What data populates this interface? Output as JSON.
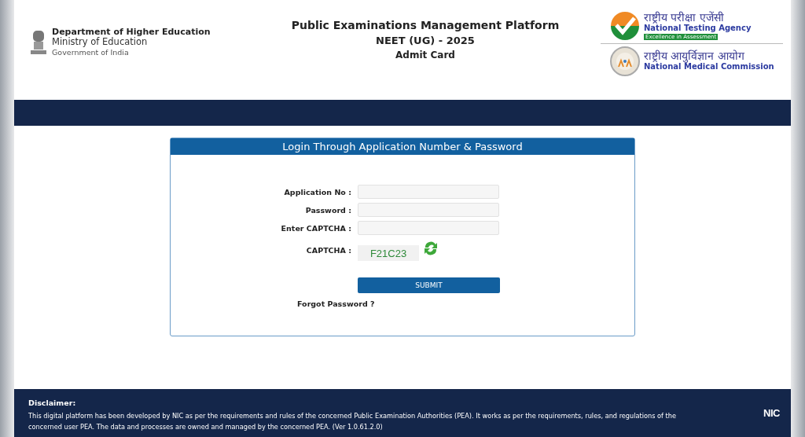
{
  "header": {
    "department": {
      "name": "Department of Higher Education",
      "ministry": "Ministry of Education",
      "government": "Government of India"
    },
    "title": "Public Examinations Management Platform",
    "subtitle": "NEET (UG) - 2025",
    "page": "Admit Card",
    "agencies": [
      {
        "kind": "nta",
        "hindi": "राष्ट्रीय परीक्षा एजेंसी",
        "english": "National Testing Agency",
        "tagline": "Excellence in Assessment"
      },
      {
        "kind": "nmc",
        "hindi": "राष्ट्रीय आयुर्विज्ञान आयोग",
        "english": "National Medical Commission"
      }
    ]
  },
  "login": {
    "title": "Login Through Application Number & Password",
    "fields": [
      {
        "kind": "input",
        "label": "Application No :"
      },
      {
        "kind": "input",
        "label": "Password :"
      },
      {
        "kind": "input",
        "label": "Enter CAPTCHA :"
      },
      {
        "kind": "captcha",
        "label": "CAPTCHA :",
        "value": "F21C23"
      }
    ],
    "submit": "SUBMIT",
    "forgot": "Forgot Password ?"
  },
  "footer": {
    "heading": "Disclaimer:",
    "text": "This digital platform has been developed by NIC as per the requirements and rules of the concerned Public Examination Authorities (PEA). It works as per the requirements, rules, and regulations of the concerned user PEA. The data and processes are owned and managed by the concerned PEA. (Ver 1.0.61.2.0)",
    "logo": "NIC"
  }
}
